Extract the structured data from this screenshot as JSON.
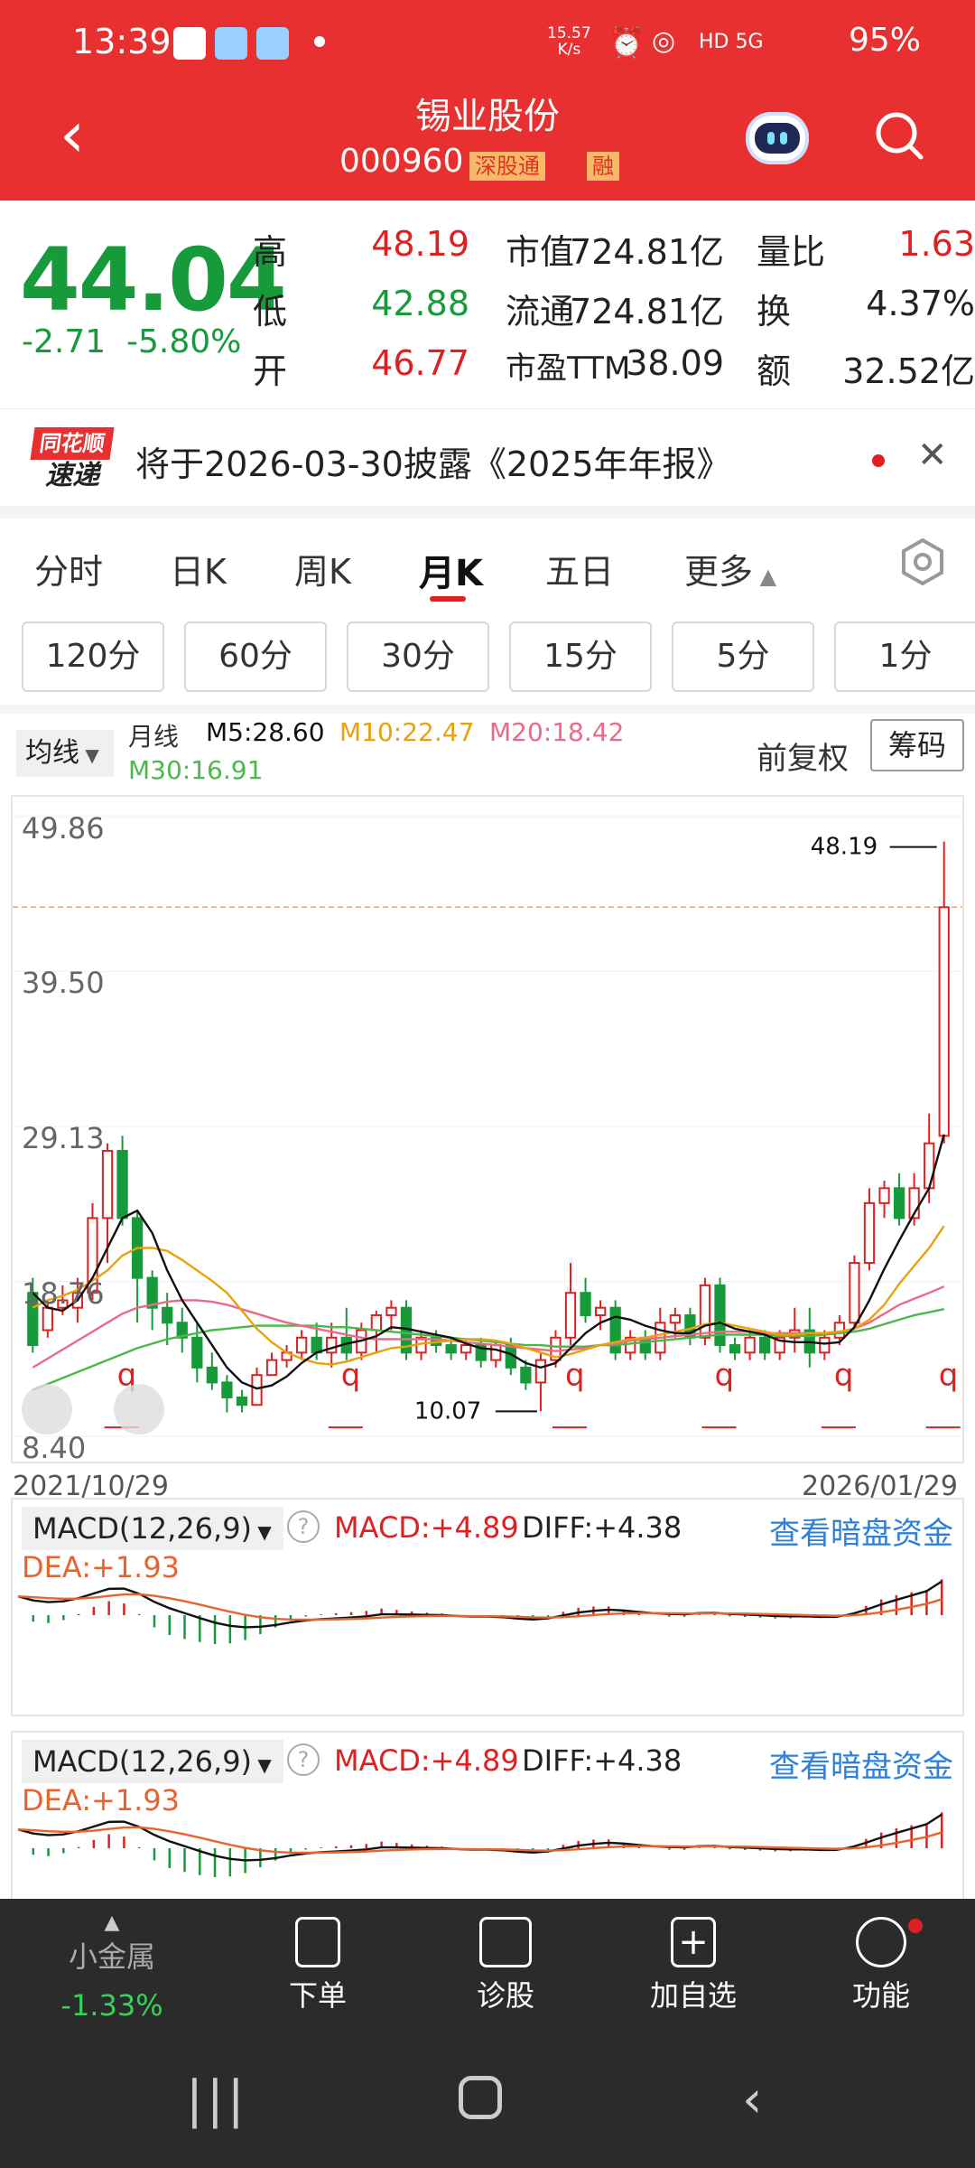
{
  "status": {
    "time": "13:39",
    "speed": "15.57",
    "speed_unit": "K/s",
    "net": "HD 5G",
    "battery": "95%"
  },
  "header": {
    "title": "锡业股份",
    "code": "000960",
    "tag1": "深股通",
    "tag2": "融"
  },
  "quote": {
    "price": "44.04",
    "change": "-2.71",
    "pct": "-5.80%",
    "rows": [
      {
        "l1": "高",
        "v1": "48.19",
        "l2": "市值",
        "v2": "724.81亿",
        "l3": "量比",
        "v3": "1.63"
      },
      {
        "l1": "低",
        "v1": "42.88",
        "l2": "流通",
        "v2": "724.81亿",
        "l3": "换",
        "v3": "4.37%"
      },
      {
        "l1": "开",
        "v1": "46.77",
        "l2": "市盈TTM",
        "v2": "38.09",
        "l3": "额",
        "v3": "32.52亿"
      }
    ]
  },
  "notice": {
    "logo_top": "同花顺",
    "logo_bottom": "速递",
    "text": "将于2026-03-30披露《2025年年报》"
  },
  "tabs": [
    "分时",
    "日K",
    "周K",
    "月K",
    "五日",
    "更多"
  ],
  "active_tab": "月K",
  "periods": [
    "120分",
    "60分",
    "30分",
    "15分",
    "5分",
    "1分"
  ],
  "ma": {
    "select": "均线",
    "label": "月线",
    "m5": "M5:28.60",
    "m10": "M10:22.47",
    "m20": "M20:18.42",
    "m30": "M30:16.91",
    "fq": "前复权",
    "chouma": "筹码"
  },
  "colors": {
    "up": "#e02020",
    "down": "#169a3a",
    "m5": "#111111",
    "m10": "#e8a20c",
    "m20": "#ea6a8a",
    "m30": "#4cb84c"
  },
  "chart_data": {
    "type": "candlestick",
    "start": "2021/10/29",
    "end": "2026/01/29",
    "y_ticks": [
      "49.86",
      "39.50",
      "29.13",
      "18.76",
      "8.40"
    ],
    "ylim": [
      8.4,
      49.86
    ],
    "max_label": "48.19",
    "min_label": "10.07",
    "candles": [
      [
        18,
        14.5,
        19,
        14
      ],
      [
        15.5,
        17,
        17.5,
        15
      ],
      [
        17,
        17.5,
        18.5,
        16.5
      ],
      [
        17,
        18,
        19,
        16
      ],
      [
        18,
        23,
        24,
        17.5
      ],
      [
        23,
        27.5,
        28,
        20
      ],
      [
        27.5,
        23,
        28.5,
        22.5
      ],
      [
        23,
        19,
        23.5,
        16
      ],
      [
        19,
        17,
        19.5,
        15.5
      ],
      [
        17,
        16,
        18,
        14.5
      ],
      [
        16,
        15,
        17,
        14
      ],
      [
        15,
        13,
        16,
        12
      ],
      [
        13,
        12,
        14,
        11.5
      ],
      [
        12,
        11,
        12.5,
        10
      ],
      [
        11,
        10.5,
        11.5,
        10
      ],
      [
        10.5,
        12.5,
        13,
        10.5
      ],
      [
        12.5,
        13.5,
        14,
        12.5
      ],
      [
        13.5,
        14,
        14.5,
        13
      ],
      [
        14,
        15,
        15.5,
        13.5
      ],
      [
        15,
        14,
        16,
        13.5
      ],
      [
        14,
        15,
        16,
        13
      ],
      [
        15,
        14,
        17,
        13.5
      ],
      [
        14,
        15.5,
        16,
        13.5
      ],
      [
        15.5,
        16.5,
        16.8,
        14
      ],
      [
        16.5,
        17,
        17.5,
        15.5
      ],
      [
        17,
        14,
        17.5,
        13.5
      ],
      [
        14,
        15,
        15.5,
        13.5
      ],
      [
        15,
        14.5,
        15.5,
        14
      ],
      [
        14.5,
        14,
        15,
        13.5
      ],
      [
        14,
        14.5,
        14.8,
        13.5
      ],
      [
        14.5,
        13.5,
        15,
        13
      ],
      [
        13.5,
        14.5,
        14.8,
        13
      ],
      [
        14.5,
        13,
        15,
        12.5
      ],
      [
        13,
        12,
        13.5,
        11.5
      ],
      [
        12,
        13.5,
        14,
        10.07
      ],
      [
        13.5,
        15,
        15.5,
        13
      ],
      [
        15,
        18,
        20,
        14.5
      ],
      [
        18,
        16.5,
        19,
        16
      ],
      [
        16.5,
        17,
        17.5,
        15.5
      ],
      [
        17,
        14,
        17.5,
        13.5
      ],
      [
        14,
        15,
        15.5,
        13.5
      ],
      [
        15,
        14,
        15.5,
        13.5
      ],
      [
        14,
        16,
        17,
        13.5
      ],
      [
        16,
        16.5,
        17,
        15
      ],
      [
        16.5,
        15,
        17,
        14.5
      ],
      [
        15,
        18.5,
        19,
        14.5
      ],
      [
        18.5,
        14.5,
        19,
        14
      ],
      [
        14.5,
        14,
        15,
        13.5
      ],
      [
        14,
        15,
        15.5,
        13.5
      ],
      [
        15,
        14,
        15.5,
        13.5
      ],
      [
        14,
        15,
        15.5,
        13.5
      ],
      [
        15,
        15.5,
        17,
        14
      ],
      [
        15.5,
        14,
        17,
        13
      ],
      [
        14,
        15,
        15.5,
        13.5
      ],
      [
        15,
        16,
        16.5,
        14.5
      ],
      [
        16,
        20,
        20.5,
        15.5
      ],
      [
        20,
        24,
        25,
        19.5
      ],
      [
        24,
        25,
        25.5,
        23
      ],
      [
        25,
        23,
        26,
        22.5
      ],
      [
        23,
        25,
        26,
        22.5
      ],
      [
        25,
        28,
        30,
        24
      ],
      [
        28.5,
        43.8,
        48.19,
        28
      ]
    ],
    "ma5": [
      18,
      17,
      16.8,
      17.5,
      19,
      21,
      23,
      23.5,
      22,
      19.5,
      17.5,
      16,
      14.5,
      13,
      12,
      11.6,
      11.8,
      12.4,
      13.3,
      14,
      14.3,
      14.6,
      14.8,
      15.1,
      15.7,
      15.6,
      15.4,
      15.2,
      15,
      14.6,
      14.3,
      14.2,
      13.9,
      13.3,
      13,
      13.3,
      14.3,
      15.3,
      16,
      16.4,
      16.2,
      15.8,
      15.5,
      15.3,
      15.3,
      15.8,
      16,
      15.6,
      15.4,
      15.2,
      14.8,
      14.7,
      14.7,
      14.6,
      14.7,
      15.7,
      17.5,
      19.6,
      21.5,
      23.3,
      25,
      28.6
    ],
    "ma10": [
      17,
      17.5,
      17.8,
      18.2,
      18.8,
      19.5,
      20.5,
      21,
      21,
      20.8,
      20.2,
      19.5,
      18.8,
      18,
      16.8,
      15.6,
      14.7,
      14,
      13.6,
      13.3,
      13.2,
      13.4,
      13.7,
      14,
      14.3,
      14.4,
      14.6,
      14.7,
      14.8,
      14.9,
      14.9,
      14.8,
      14.6,
      14.3,
      14,
      13.7,
      13.9,
      14.2,
      14.5,
      14.7,
      14.9,
      15,
      15.2,
      15.4,
      15.6,
      15.9,
      16,
      15.8,
      15.6,
      15.4,
      15.2,
      15.2,
      15.3,
      15.3,
      15.4,
      15.6,
      16.2,
      17.2,
      18.6,
      19.8,
      21,
      22.47
    ],
    "ma20": [
      13,
      13.6,
      14.2,
      14.8,
      15.4,
      16,
      16.6,
      17,
      17.2,
      17.4,
      17.5,
      17.5,
      17.4,
      17.2,
      16.9,
      16.6,
      16.3,
      16,
      15.8,
      15.6,
      15.4,
      15.2,
      15,
      14.9,
      14.9,
      14.9,
      14.9,
      14.9,
      14.8,
      14.7,
      14.6,
      14.5,
      14.4,
      14.3,
      14.2,
      14.1,
      14.2,
      14.3,
      14.5,
      14.6,
      14.8,
      14.9,
      15,
      15.1,
      15.2,
      15.3,
      15.4,
      15.4,
      15.4,
      15.3,
      15.3,
      15.3,
      15.3,
      15.3,
      15.4,
      15.6,
      16,
      16.6,
      17.2,
      17.6,
      18,
      18.42
    ],
    "ma30": [
      11.5,
      11.9,
      12.3,
      12.7,
      13.1,
      13.5,
      13.9,
      14.3,
      14.6,
      14.9,
      15.1,
      15.3,
      15.5,
      15.6,
      15.7,
      15.8,
      15.8,
      15.8,
      15.8,
      15.8,
      15.7,
      15.7,
      15.6,
      15.5,
      15.4,
      15.3,
      15.2,
      15.1,
      15,
      14.9,
      14.8,
      14.7,
      14.6,
      14.5,
      14.5,
      14.4,
      14.4,
      14.4,
      14.5,
      14.5,
      14.6,
      14.7,
      14.8,
      14.9,
      15,
      15.1,
      15.2,
      15.2,
      15.2,
      15.2,
      15.1,
      15.1,
      15.1,
      15.2,
      15.3,
      15.4,
      15.6,
      15.9,
      16.2,
      16.5,
      16.7,
      16.91
    ]
  },
  "macd": {
    "select": "MACD(12,26,9)",
    "macd": "MACD:+4.89",
    "diff": "DIFF:+4.38",
    "dea": "DEA:+1.93",
    "link": "查看暗盘资金"
  },
  "bottom": {
    "item0_label": "小金属",
    "item0_value": "-1.33%",
    "items": [
      "下单",
      "诊股",
      "加自选",
      "功能"
    ]
  }
}
